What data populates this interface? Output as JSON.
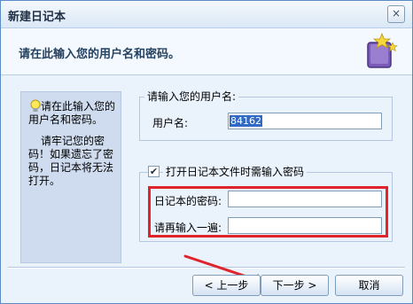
{
  "window": {
    "title": "新建日记本",
    "close_symbol": "×"
  },
  "header": {
    "text": "请在此输入您的用户名和密码。"
  },
  "side_panel": {
    "tip1": "请在此输入您的用户名和密码。",
    "tip2": "请牢记您的密码！如果遗忘了密码，日记本将无法打开。"
  },
  "user_group": {
    "title": "请输入您的用户名:",
    "label": "用户名:",
    "value": "84162"
  },
  "password_group": {
    "checkbox_label": "打开日记本文件时需输入密码",
    "checked": true,
    "check_mark": "✔",
    "password_label": "日记本的密码:",
    "repeat_label": "请再输入一遍:",
    "password_value": "",
    "repeat_value": ""
  },
  "buttons": {
    "prev": "< 上一步",
    "next": "下一步 >",
    "cancel": "取消"
  },
  "colors": {
    "annotation_red": "#e0242c",
    "selection_blue": "#316ac5"
  }
}
